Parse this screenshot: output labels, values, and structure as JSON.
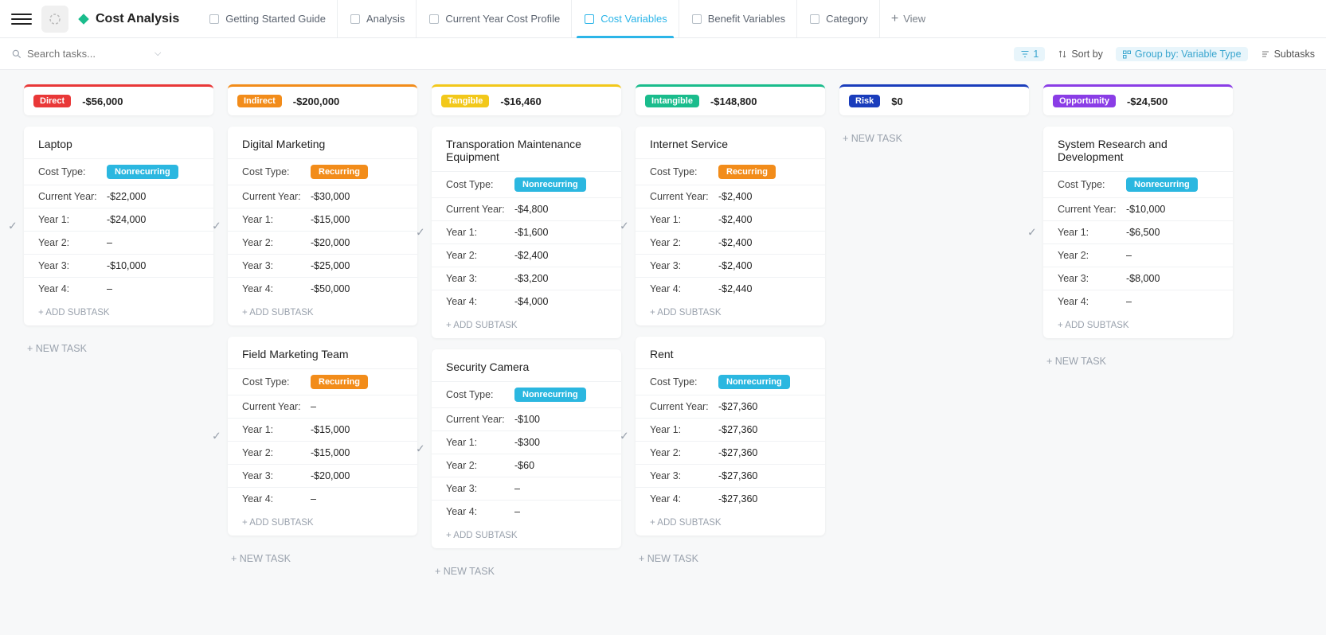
{
  "header": {
    "title": "Cost Analysis",
    "tabs": [
      {
        "label": "Getting Started Guide",
        "active": false
      },
      {
        "label": "Analysis",
        "active": false
      },
      {
        "label": "Current Year Cost Profile",
        "active": false
      },
      {
        "label": "Cost Variables",
        "active": true
      },
      {
        "label": "Benefit Variables",
        "active": false
      },
      {
        "label": "Category",
        "active": false
      }
    ],
    "add_view": "View"
  },
  "toolbar": {
    "search_placeholder": "Search tasks...",
    "filter_count": "1",
    "sort_label": "Sort by",
    "group_label": "Group by: Variable Type",
    "subtasks_label": "Subtasks"
  },
  "labels": {
    "cost_type": "Cost Type:",
    "current_year": "Current Year:",
    "year1": "Year 1:",
    "year2": "Year 2:",
    "year3": "Year 3:",
    "year4": "Year 4:",
    "add_subtask": "+ ADD SUBTASK",
    "new_task": "+ NEW TASK"
  },
  "cost_types": {
    "nonrecurring": "Nonrecurring",
    "recurring": "Recurring"
  },
  "columns": [
    {
      "id": "direct",
      "name": "Direct",
      "amount": "-$56,000",
      "color": "#e93838",
      "cards": [
        {
          "title": "Laptop",
          "cost_type": "nonrecurring",
          "current_year": "-$22,000",
          "year1": "-$24,000",
          "year2": "–",
          "year3": "-$10,000",
          "year4": "–"
        }
      ]
    },
    {
      "id": "indirect",
      "name": "Indirect",
      "amount": "-$200,000",
      "color": "#f28c1a",
      "cards": [
        {
          "title": "Digital Marketing",
          "cost_type": "recurring",
          "current_year": "-$30,000",
          "year1": "-$15,000",
          "year2": "-$20,000",
          "year3": "-$25,000",
          "year4": "-$50,000"
        },
        {
          "title": "Field Marketing Team",
          "cost_type": "recurring",
          "current_year": "–",
          "year1": "-$15,000",
          "year2": "-$15,000",
          "year3": "-$20,000",
          "year4": "–"
        }
      ]
    },
    {
      "id": "tangible",
      "name": "Tangible",
      "amount": "-$16,460",
      "color": "#f2c81a",
      "cards": [
        {
          "title": "Transporation Maintenance Equipment",
          "cost_type": "nonrecurring",
          "current_year": "-$4,800",
          "year1": "-$1,600",
          "year2": "-$2,400",
          "year3": "-$3,200",
          "year4": "-$4,000"
        },
        {
          "title": "Security Camera",
          "cost_type": "nonrecurring",
          "current_year": "-$100",
          "year1": "-$300",
          "year2": "-$60",
          "year3": "–",
          "year4": "–"
        }
      ]
    },
    {
      "id": "intangible",
      "name": "Intangible",
      "amount": "-$148,800",
      "color": "#1abc8c",
      "cards": [
        {
          "title": "Internet Service",
          "cost_type": "recurring",
          "current_year": "-$2,400",
          "year1": "-$2,400",
          "year2": "-$2,400",
          "year3": "-$2,400",
          "year4": "-$2,440"
        },
        {
          "title": "Rent",
          "cost_type": "nonrecurring",
          "current_year": "-$27,360",
          "year1": "-$27,360",
          "year2": "-$27,360",
          "year3": "-$27,360",
          "year4": "-$27,360"
        }
      ]
    },
    {
      "id": "risk",
      "name": "Risk",
      "amount": "$0",
      "color": "#1a3dbc",
      "cards": []
    },
    {
      "id": "opportunity",
      "name": "Opportunity",
      "amount": "-$24,500",
      "color": "#8a3de6",
      "cards": [
        {
          "title": "System Research and Development",
          "cost_type": "nonrecurring",
          "current_year": "-$10,000",
          "year1": "-$6,500",
          "year2": "–",
          "year3": "-$8,000",
          "year4": "–"
        }
      ]
    }
  ]
}
